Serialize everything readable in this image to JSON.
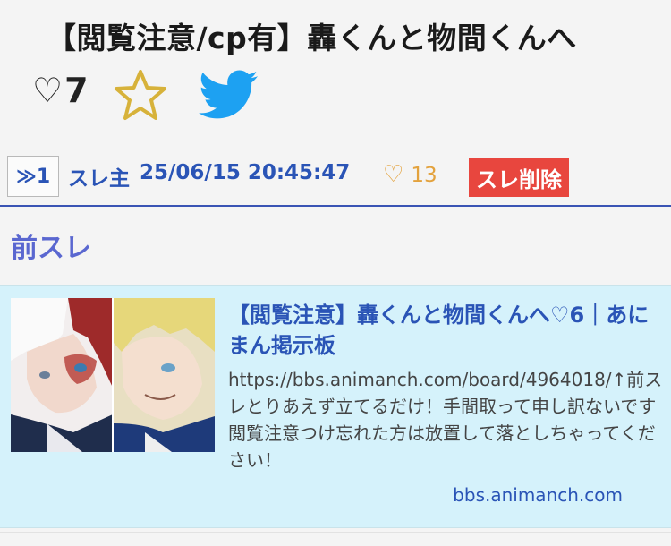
{
  "thread": {
    "title": "【閲覧注意/cp有】轟くんと物間くんへ",
    "favorite_glyph": "♡",
    "favorite_count": "7"
  },
  "post": {
    "anchor_label": "≫1",
    "owner_label": "スレ主",
    "datetime": "25/06/15 20:45:47",
    "heart_glyph": "♡",
    "like_count": "13",
    "delete_label": "スレ削除"
  },
  "previous_thread": {
    "heading": "前スレ",
    "link_title": "【閲覧注意】轟くんと物間くんへ♡6｜あにまん掲示板",
    "link_description": "https://bbs.animanch.com/board/4964018/↑前スレとりあえず立てるだけ！手間取って申し訳ないです閲覧注意つけ忘れた方は放置して落としちゃってください！",
    "link_domain": "bbs.animanch.com"
  },
  "icons": {
    "star": "star-outline-icon",
    "twitter": "twitter-bird-icon"
  },
  "colors": {
    "accent_blue": "#2a54b6",
    "star_gold": "#d7b23a",
    "twitter_blue": "#1da1f2",
    "delete_red": "#e8463e",
    "like_orange": "#e3a23d",
    "card_bg": "#d5f2fb"
  }
}
